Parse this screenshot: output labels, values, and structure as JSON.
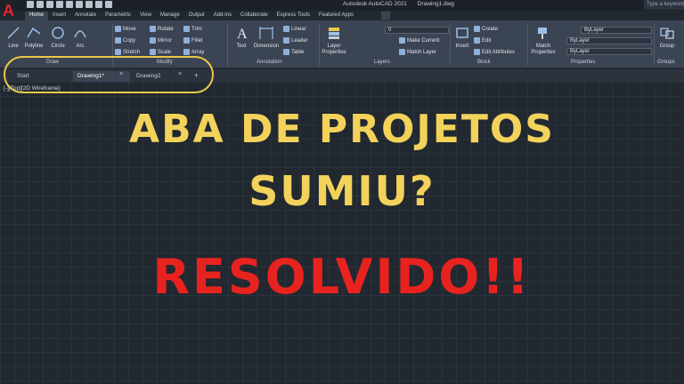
{
  "window": {
    "title_app": "Autodesk AutoCAD 2021",
    "title_file": "Drawing1.dwg",
    "search_placeholder": "Type a keyword or"
  },
  "ribbon_tabs": [
    "Home",
    "Insert",
    "Annotate",
    "Parametric",
    "View",
    "Manage",
    "Output",
    "Add-ins",
    "Collaborate",
    "Express Tools",
    "Featured Apps"
  ],
  "ribbon": {
    "draw": {
      "label": "Draw",
      "line": "Line",
      "polyline": "Polyline",
      "circle": "Circle",
      "arc": "Arc"
    },
    "modify": {
      "label": "Modify",
      "move": "Move",
      "rotate": "Rotate",
      "trim": "Trim",
      "copy": "Copy",
      "mirror": "Mirror",
      "fillet": "Fillet",
      "stretch": "Stretch",
      "scale": "Scale",
      "array": "Array"
    },
    "annotation": {
      "label": "Annotation",
      "text": "Text",
      "dimension": "Dimension",
      "linear": "Linear",
      "leader": "Leader",
      "table": "Table"
    },
    "layers": {
      "label": "Layers",
      "layer_properties": "Layer Properties",
      "current_layer": "0",
      "make_current": "Make Current",
      "match_layer": "Match Layer"
    },
    "block": {
      "label": "Block",
      "insert": "Insert",
      "create": "Create",
      "edit": "Edit",
      "edit_attributes": "Edit Attributes"
    },
    "properties": {
      "label": "Properties",
      "match_properties": "Match Properties",
      "bylayer_1": "ByLayer",
      "bylayer_2": "ByLayer",
      "bylayer_3": "ByLayer"
    },
    "groups": {
      "label": "Groups",
      "group": "Group"
    }
  },
  "file_tabs": {
    "start": "Start",
    "drawing1": "Drawing1*",
    "drawing2": "Drawing2",
    "close": "×",
    "add": "+"
  },
  "viewport_label": "[-][Top][2D Wireframe]",
  "overlay": {
    "line1": "ABA DE PROJETOS",
    "line2": "SUMIU?",
    "line3": "RESOLVIDO!!"
  },
  "colors": {
    "headline_yellow": "#f2d25a",
    "headline_red": "#e8231f",
    "highlight": "#e8c94a",
    "logo_red": "#e0242a"
  }
}
